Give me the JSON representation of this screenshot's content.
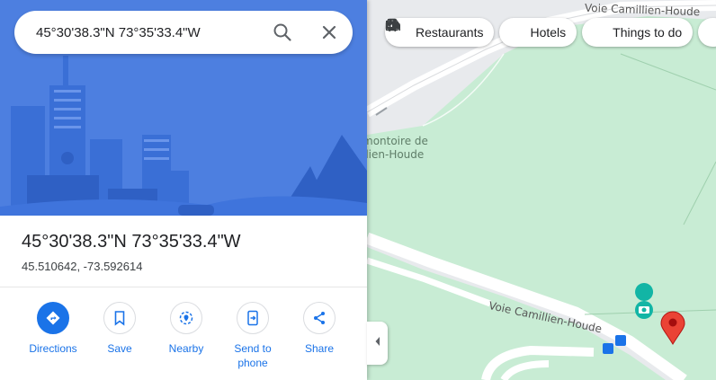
{
  "search": {
    "value": "45°30'38.3\"N 73°35'33.4\"W"
  },
  "place": {
    "title": "45°30'38.3\"N 73°35'33.4\"W",
    "decimal": "45.510642, -73.592614"
  },
  "actions": [
    {
      "label": "Directions",
      "icon": "directions-icon"
    },
    {
      "label": "Save",
      "icon": "bookmark-icon"
    },
    {
      "label": "Nearby",
      "icon": "nearby-icon"
    },
    {
      "label": "Send to phone",
      "icon": "send-to-phone-icon"
    },
    {
      "label": "Share",
      "icon": "share-icon"
    }
  ],
  "chips": [
    {
      "label": "Restaurants",
      "icon": "fork-knife-icon"
    },
    {
      "label": "Hotels",
      "icon": "bed-icon"
    },
    {
      "label": "Things to do",
      "icon": "camera-icon"
    }
  ],
  "map": {
    "road_top": "Voie Camillien-Houde",
    "road_bottom": "Voie Camillien-Houde",
    "poi_line1": "montoire de",
    "poi_line2": "ilien-Houde"
  },
  "colors": {
    "accent": "#1a73e8",
    "park": "#c8ecd4",
    "pin": "#ea4335",
    "hero": "#4d7fe0"
  }
}
